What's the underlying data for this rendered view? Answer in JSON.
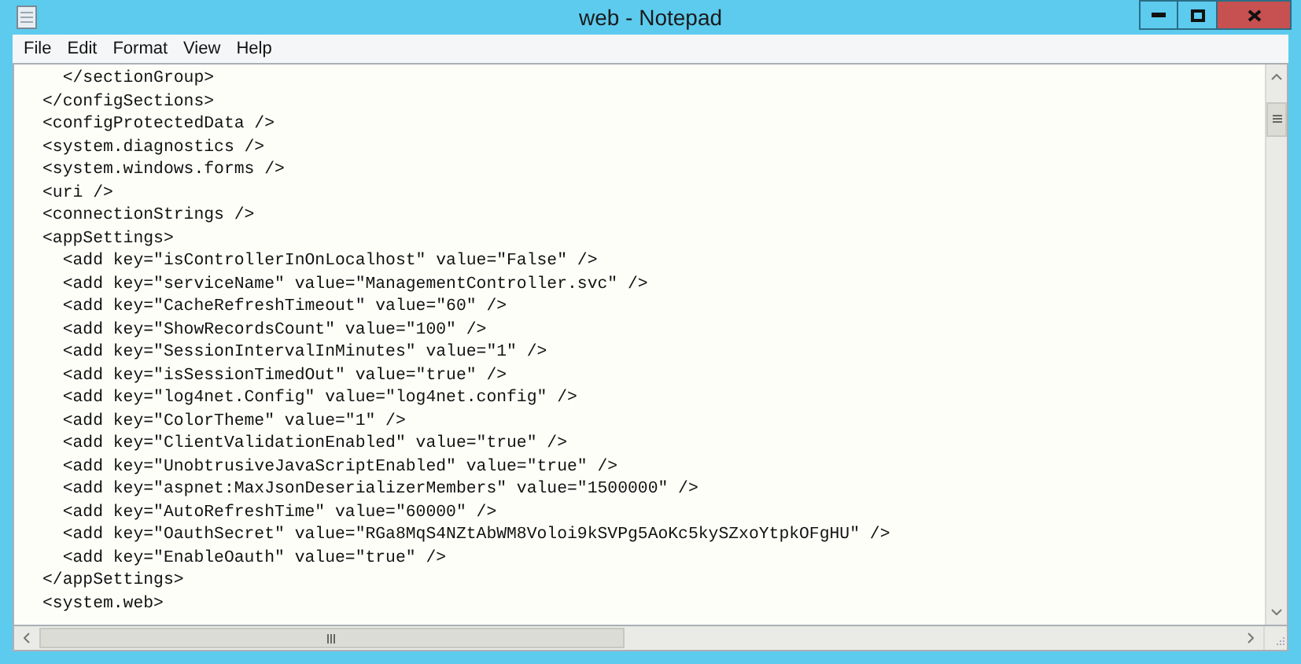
{
  "window": {
    "title": "web - Notepad"
  },
  "menu": [
    "File",
    "Edit",
    "Format",
    "View",
    "Help"
  ],
  "lines": [
    "  </sectionGroup>",
    "</configSections>",
    "<configProtectedData />",
    "<system.diagnostics />",
    "<system.windows.forms />",
    "<uri />",
    "<connectionStrings />",
    "<appSettings>",
    "  <add key=\"isControllerInOnLocalhost\" value=\"False\" />",
    "  <add key=\"serviceName\" value=\"ManagementController.svc\" />",
    "  <add key=\"CacheRefreshTimeout\" value=\"60\" />",
    "  <add key=\"ShowRecordsCount\" value=\"100\" />",
    "  <add key=\"SessionIntervalInMinutes\" value=\"1\" />",
    "  <add key=\"isSessionTimedOut\" value=\"true\" />",
    "  <add key=\"log4net.Config\" value=\"log4net.config\" />",
    "  <add key=\"ColorTheme\" value=\"1\" />",
    "  <add key=\"ClientValidationEnabled\" value=\"true\" />",
    "  <add key=\"UnobtrusiveJavaScriptEnabled\" value=\"true\" />",
    "  <add key=\"aspnet:MaxJsonDeserializerMembers\" value=\"1500000\" />",
    "  <add key=\"AutoRefreshTime\" value=\"60000\" />",
    "  <add key=\"OauthSecret\" value=\"RGa8MqS4NZtAbWM8Voloi9kSVPg5AoKc5kySZxoYtpkOFgHU\" />",
    "  <add key=\"EnableOauth\" value=\"true\" />",
    "</appSettings>",
    "<system.web>"
  ]
}
